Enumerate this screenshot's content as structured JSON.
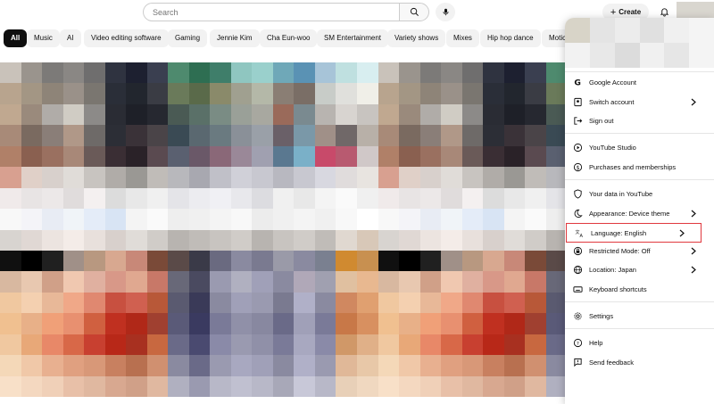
{
  "header": {
    "search_placeholder": "Search",
    "create_label": "Create"
  },
  "chips": [
    "All",
    "Music",
    "AI",
    "Video editing software",
    "Gaming",
    "Jennie Kim",
    "Cha Eun-woo",
    "SM Entertainment",
    "Variety shows",
    "Mixes",
    "Hip hop dance",
    "Motic"
  ],
  "menu": {
    "items": [
      {
        "label": "Google Account",
        "icon": "google-icon"
      },
      {
        "label": "Switch account",
        "icon": "switch-account-icon",
        "chevron": true
      },
      {
        "label": "Sign out",
        "icon": "sign-out-icon"
      },
      {
        "label": "YouTube Studio",
        "icon": "studio-icon"
      },
      {
        "label": "Purchases and memberships",
        "icon": "dollar-icon"
      },
      {
        "label": "Your data in YouTube",
        "icon": "shield-icon"
      },
      {
        "label": "Appearance: Device theme",
        "icon": "moon-icon",
        "chevron": true
      },
      {
        "label": "Language: English",
        "icon": "translate-icon",
        "chevron": true,
        "highlighted": true
      },
      {
        "label": "Restricted Mode: Off",
        "icon": "restricted-icon",
        "chevron": true
      },
      {
        "label": "Location: Japan",
        "icon": "globe-icon",
        "chevron": true
      },
      {
        "label": "Keyboard shortcuts",
        "icon": "keyboard-icon"
      },
      {
        "label": "Settings",
        "icon": "gear-icon"
      },
      {
        "label": "Help",
        "icon": "help-icon"
      },
      {
        "label": "Send feedback",
        "icon": "feedback-icon"
      }
    ]
  },
  "colors": {
    "highlight": "#e0383e",
    "chip_active": "#0f0f0f",
    "chip_bg": "#f2f2f2"
  }
}
